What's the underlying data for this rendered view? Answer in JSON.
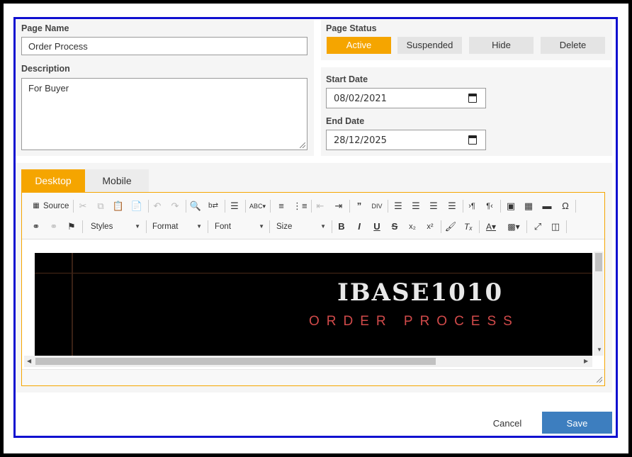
{
  "left_form": {
    "page_name_label": "Page Name",
    "page_name_value": "Order Process",
    "description_label": "Description",
    "description_value": "For Buyer"
  },
  "status": {
    "label": "Page Status",
    "options": [
      "Active",
      "Suspended",
      "Hide",
      "Delete"
    ],
    "selected": "Active"
  },
  "dates": {
    "start_label": "Start Date",
    "start_value": "08/02/2021",
    "end_label": "End Date",
    "end_value": "28/12/2025"
  },
  "tabs": [
    {
      "label": "Desktop",
      "active": true
    },
    {
      "label": "Mobile",
      "active": false
    }
  ],
  "toolbar": {
    "source_label": "Source",
    "styles_label": "Styles",
    "format_label": "Format",
    "font_label": "Font",
    "size_label": "Size"
  },
  "banner": {
    "title": "IBASE1010",
    "subtitle": "ORDER PROCESS"
  },
  "actions": {
    "cancel_label": "Cancel",
    "save_label": "Save"
  },
  "colors": {
    "accent": "#f5a500",
    "primary_button": "#3d7ebf",
    "frame_border": "#1010d0"
  }
}
